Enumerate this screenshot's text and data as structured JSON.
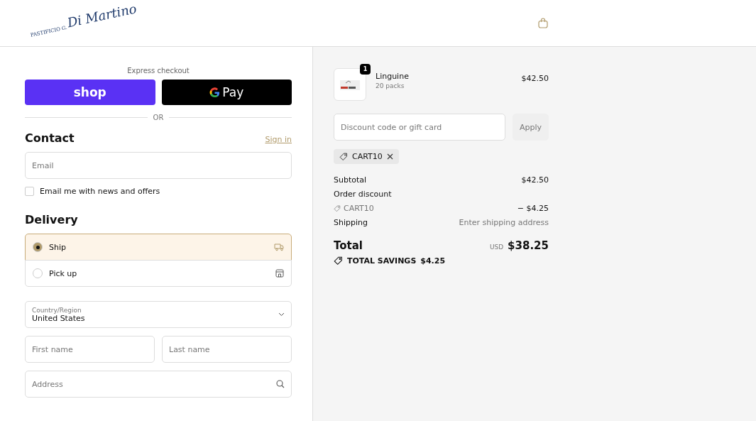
{
  "header": {
    "logo": {
      "small": "PASTIFICIO G.",
      "large": "Di Martino"
    }
  },
  "express": {
    "title": "Express checkout",
    "shop_button": "shop",
    "gpay_button": "Pay",
    "divider": "OR"
  },
  "contact": {
    "title": "Contact",
    "sign_in": "Sign in",
    "email": {
      "placeholder": "Email"
    },
    "newsletter": {
      "label": "Email me with news and offers",
      "checked": false
    }
  },
  "delivery": {
    "title": "Delivery",
    "options": [
      {
        "label": "Ship",
        "kind": "ship",
        "selected": true
      },
      {
        "label": "Pick up",
        "kind": "pickup",
        "selected": false
      }
    ]
  },
  "address": {
    "country": {
      "label": "Country/Region",
      "value": "United States"
    },
    "first_name": {
      "placeholder": "First name"
    },
    "last_name": {
      "placeholder": "Last name"
    },
    "address": {
      "placeholder": "Address"
    }
  },
  "summary": {
    "items": [
      {
        "name": "Linguine",
        "variant": "20 packs",
        "quantity": "1",
        "price": "$42.50"
      }
    ],
    "discount": {
      "placeholder": "Discount code or gift card",
      "button": "Apply",
      "disabled": true
    },
    "applied_code": "CART10",
    "lines": [
      {
        "kind": "plain",
        "label": "Subtotal",
        "value": "$42.50"
      },
      {
        "kind": "heading",
        "label": "Order discount"
      },
      {
        "kind": "code",
        "label": "CART10",
        "value": "− $4.25"
      },
      {
        "kind": "muted",
        "label": "Shipping",
        "value": "Enter shipping address"
      }
    ],
    "total": {
      "label": "Total",
      "currency": "USD",
      "value": "$38.25"
    },
    "savings": {
      "label": "TOTAL SAVINGS",
      "value": "$4.25"
    }
  }
}
